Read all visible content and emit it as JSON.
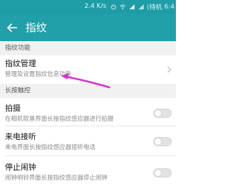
{
  "status_bar": {
    "speed": "2.4 K/s",
    "battery_text": "(待机",
    "time": "6:4"
  },
  "app_bar": {
    "title": "指纹"
  },
  "sections": [
    {
      "header": "指纹功能",
      "items": [
        {
          "title": "指纹管理",
          "subtitle": "管理及设置指纹信息功能",
          "control": "chevron"
        }
      ]
    },
    {
      "header": "长按触控",
      "items": [
        {
          "title": "拍摄",
          "subtitle": "在相机取景界面长按指纹感应器进行拍摄",
          "control": "toggle",
          "on": false
        },
        {
          "title": "来电接听",
          "subtitle": "来电界面长按指纹感应器接听电话",
          "control": "toggle",
          "on": false
        },
        {
          "title": "停止闹钟",
          "subtitle": "闹钟响铃界面长按指纹感应器停止闹钟",
          "control": "toggle",
          "on": false
        }
      ]
    }
  ],
  "colors": {
    "status_bar": "#1f9da6",
    "app_bar": "#21a0a9",
    "annotation_arrow": "#d633c9"
  },
  "icons": {
    "back": "arrow-left-icon",
    "chevron": "chevron-right-icon",
    "wifi": "wifi-icon",
    "signal": "signal-icon",
    "alarm": "alarm-icon"
  }
}
